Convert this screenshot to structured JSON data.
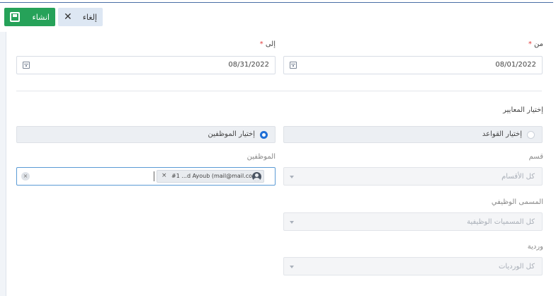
{
  "toolbar": {
    "create_label": "انشاء",
    "cancel_label": "إلغاء"
  },
  "dates": {
    "from_label": "من",
    "to_label": "إلى",
    "required_mark": "*",
    "from_value": "08/01/2022",
    "to_value": "08/31/2022"
  },
  "criteria": {
    "heading": "إختيار المعايير",
    "option_rules": "إختيار القواعد",
    "option_employees": "إختيار الموظفين",
    "selected": "option_employees"
  },
  "filters": {
    "department_label": "قسم",
    "department_placeholder": "كل الأقسام",
    "jobtitle_label": "المسمى الوظيفي",
    "jobtitle_placeholder": "كل المسميات الوظيفية",
    "shift_label": "وردية",
    "shift_placeholder": "كل الورديات"
  },
  "employees": {
    "label": "الموظفين",
    "chip_text": "#1 ...d Ayoub (mail@mail.com)",
    "chip_remove": "×",
    "clear_all": "×"
  }
}
